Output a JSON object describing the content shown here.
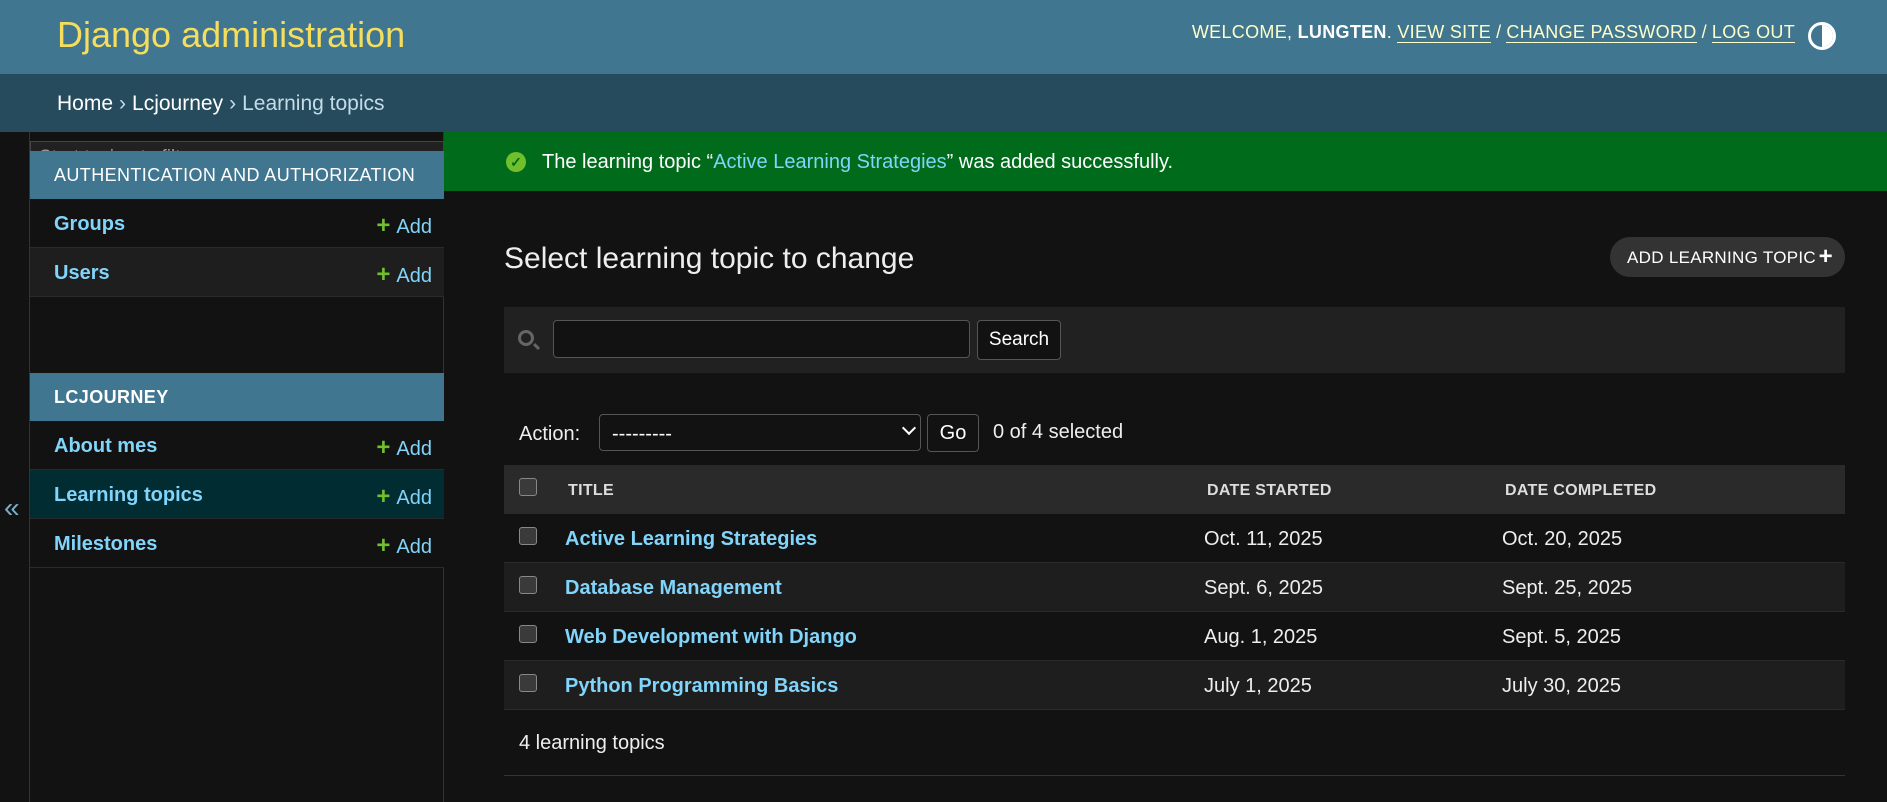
{
  "header": {
    "site_name": "Django administration",
    "welcome": "WELCOME,",
    "username": "LUNGTEN",
    "username_suffix": ".",
    "view_site": "VIEW SITE",
    "change_password": "CHANGE PASSWORD",
    "log_out": "LOG OUT",
    "separator": "/"
  },
  "breadcrumbs": {
    "items": [
      "Home",
      "Lcjourney",
      "Learning topics"
    ],
    "separator": "›"
  },
  "sidebar": {
    "toggle": "«",
    "filter_placeholder": "Start typing to filter...",
    "modules": [
      {
        "caption": "AUTHENTICATION AND AUTHORIZATION",
        "models": [
          {
            "name": "Groups",
            "add": "Add"
          },
          {
            "name": "Users",
            "add": "Add"
          }
        ]
      },
      {
        "caption": "LCJOURNEY",
        "models": [
          {
            "name": "About mes",
            "add": "Add"
          },
          {
            "name": "Learning topics",
            "add": "Add"
          },
          {
            "name": "Milestones",
            "add": "Add"
          }
        ]
      }
    ]
  },
  "message": {
    "prefix": "The learning topic “",
    "link": "Active Learning Strategies",
    "suffix": "” was added successfully."
  },
  "content": {
    "title": "Select learning topic to change",
    "add_button": "ADD LEARNING TOPIC"
  },
  "search": {
    "value": "",
    "button": "Search"
  },
  "actions": {
    "label": "Action:",
    "selected_option": "---------",
    "go": "Go",
    "selected_count": "0 of 4 selected"
  },
  "table": {
    "columns": [
      "TITLE",
      "DATE STARTED",
      "DATE COMPLETED"
    ],
    "rows": [
      {
        "title": "Active Learning Strategies",
        "date_started": "Oct. 11, 2025",
        "date_completed": "Oct. 20, 2025"
      },
      {
        "title": "Database Management",
        "date_started": "Sept. 6, 2025",
        "date_completed": "Sept. 25, 2025"
      },
      {
        "title": "Web Development with Django",
        "date_started": "Aug. 1, 2025",
        "date_completed": "Sept. 5, 2025"
      },
      {
        "title": "Python Programming Basics",
        "date_started": "July 1, 2025",
        "date_completed": "July 30, 2025"
      }
    ]
  },
  "paginator": {
    "text": "4 learning topics"
  },
  "colors": {
    "header_bg": "#417690",
    "site_name": "#f5dd5d",
    "breadcrumbs_bg": "#264b5d",
    "link": "#81d4fa",
    "add_plus": "#70bf2b",
    "success_bg": "#006b1b",
    "selected_row": "#002c32"
  }
}
